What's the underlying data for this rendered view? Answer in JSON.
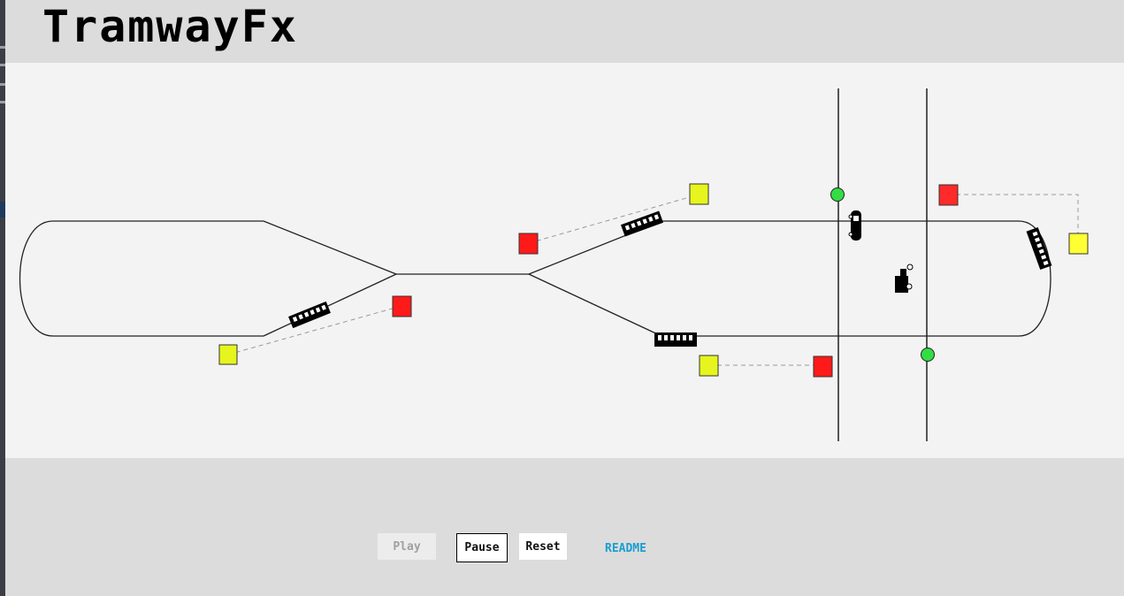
{
  "app": {
    "title": "TramwayFx"
  },
  "controls": {
    "play_label": "Play",
    "pause_label": "Pause",
    "reset_label": "Reset",
    "readme_label": "README"
  },
  "colors": {
    "header_bg": "#dcdcdc",
    "canvas_bg": "#f3f3f3",
    "signal_red": "#ff1a1a",
    "signal_yellow": "#ffff33",
    "crossing_green": "#33dd44",
    "readme_link": "#1a9fd0"
  },
  "scene": {
    "signals": [
      "red",
      "yellow",
      "red",
      "yellow",
      "red",
      "yellow",
      "red",
      "yellow"
    ],
    "crossing_lights": [
      "green",
      "green"
    ],
    "vehicles": [
      "tram",
      "tram",
      "tram",
      "tram",
      "car",
      "pedestrian"
    ]
  }
}
